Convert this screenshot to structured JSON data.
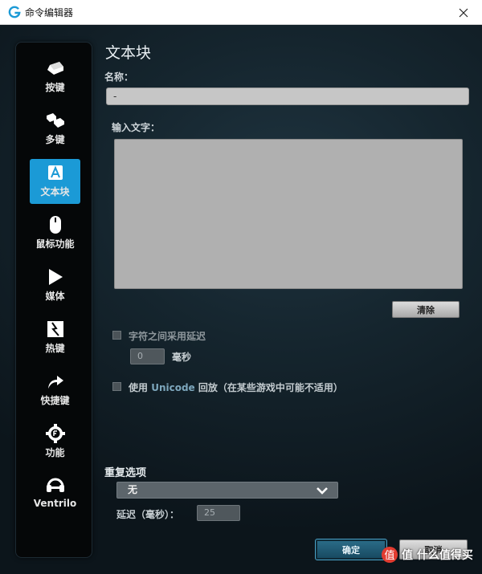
{
  "titlebar": {
    "title": "命令编辑器"
  },
  "sidebar": {
    "items": [
      {
        "label": "按键",
        "icon": "key-icon",
        "active": false
      },
      {
        "label": "多键",
        "icon": "multikey-icon",
        "active": false
      },
      {
        "label": "文本块",
        "icon": "text-block-icon",
        "active": true
      },
      {
        "label": "鼠标功能",
        "icon": "mouse-icon",
        "active": false
      },
      {
        "label": "媒体",
        "icon": "play-icon",
        "active": false
      },
      {
        "label": "热键",
        "icon": "hotkey-icon",
        "active": false
      },
      {
        "label": "快捷键",
        "icon": "shortcut-arrow-icon",
        "active": false
      },
      {
        "label": "功能",
        "icon": "function-gear-icon",
        "active": false
      },
      {
        "label": "Ventrilo",
        "icon": "headset-icon",
        "active": false
      }
    ]
  },
  "main": {
    "heading": "文本块",
    "name_label": "名称：",
    "name_value": "-",
    "text_label": "输入文字：",
    "text_value": "",
    "clear_button": "清除",
    "delay_checkbox_label": "字符之间采用延迟",
    "delay_value": "0",
    "delay_unit": "毫秒",
    "unicode_label": "使用",
    "unicode_word": "Unicode",
    "unicode_rest": "回放（在某些游戏中可能不适用）",
    "repeat_heading": "重复选项",
    "repeat_select": "无",
    "repeat_delay_label": "延迟（毫秒）：",
    "repeat_delay_value": "25",
    "ok_button": "确定",
    "cancel_button": "取消"
  },
  "watermark": {
    "text": "值 什么值得买"
  },
  "colors": {
    "accent": "#1b9ad6",
    "background": "#15252e"
  }
}
